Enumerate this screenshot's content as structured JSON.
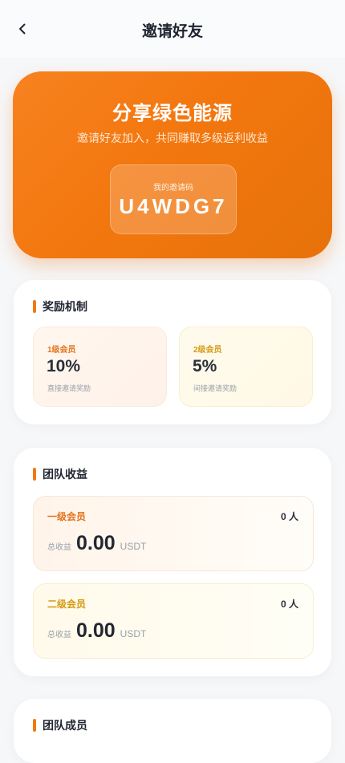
{
  "header": {
    "title": "邀请好友",
    "back_icon": "chevron-left-icon"
  },
  "hero": {
    "title": "分享绿色能源",
    "subtitle": "邀请好友加入，共同赚取多级返利收益",
    "code_label": "我的邀请码",
    "code": "U4WDG7"
  },
  "reward": {
    "title": "奖励机制",
    "items": [
      {
        "level": "1级会员",
        "rate": "10%",
        "desc": "直接邀请奖励"
      },
      {
        "level": "2级会员",
        "rate": "5%",
        "desc": "间接邀请奖励"
      }
    ]
  },
  "earnings": {
    "title": "团队收益",
    "items": [
      {
        "level": "一级会员",
        "count": "0 人",
        "label": "总收益",
        "amount": "0.00",
        "unit": "USDT"
      },
      {
        "level": "二级会员",
        "count": "0 人",
        "label": "总收益",
        "amount": "0.00",
        "unit": "USDT"
      }
    ]
  },
  "members": {
    "title": "团队成员"
  },
  "colors": {
    "accent": "#f07a12",
    "level1": "#e4731b",
    "level2": "#d69a14"
  }
}
